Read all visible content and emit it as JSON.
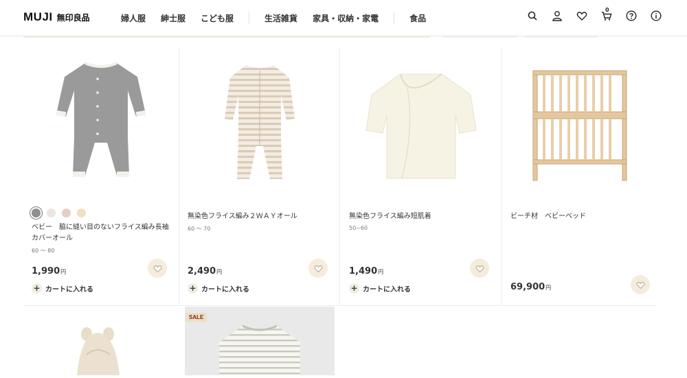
{
  "header": {
    "logo_brand": "MUJI",
    "logo_sub": "無印良品",
    "nav": [
      "婦人服",
      "紳士服",
      "こども服",
      "生活雑貨",
      "家具・収納・家電",
      "食品"
    ],
    "icons": [
      "search-icon",
      "account-icon",
      "favorite-icon",
      "cart-icon",
      "help-icon",
      "info-icon"
    ],
    "cart_count": "0"
  },
  "products": [
    {
      "name": "ベビー　脇に縫い目のないフライス編み長袖カバーオール",
      "size": "60 〜 80",
      "price": "1,990",
      "yen": "円",
      "cart_label": "カートに入れる",
      "swatches": [
        "#8e8e8e",
        "#ebe6df",
        "#e4cfc7",
        "#eee0c0"
      ]
    },
    {
      "name": "無染色フライス編み２ＷＡＹオール",
      "size": "60 〜 70",
      "price": "2,490",
      "yen": "円",
      "cart_label": "カートに入れる"
    },
    {
      "name": "無染色フライス編み短肌着",
      "size": "50~60",
      "price": "1,490",
      "yen": "円",
      "cart_label": "カートに入れる"
    },
    {
      "name": "ビーチ材　ベビーベッド",
      "price": "69,900",
      "yen": "円"
    }
  ],
  "row2": {
    "sale_badge": "SALE"
  },
  "colors": {
    "fav_bg": "#f5ecdd",
    "sale_text": "#8a1f11",
    "sale_bg": "#eadfc9"
  }
}
